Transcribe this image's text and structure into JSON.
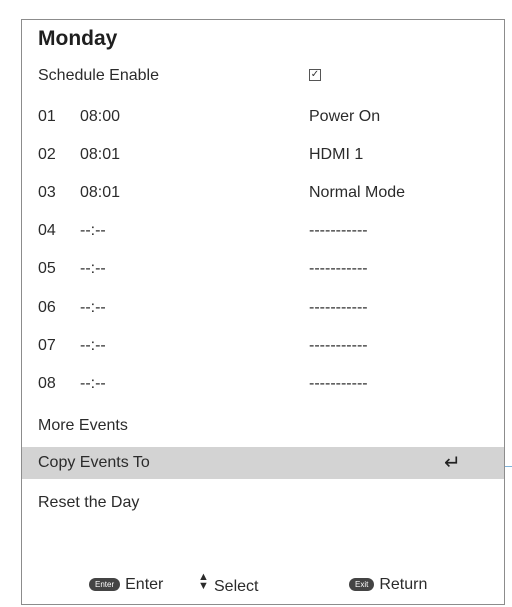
{
  "title": "Monday",
  "schedule_enable": {
    "label": "Schedule Enable",
    "checked": true,
    "check_glyph": "✓"
  },
  "events": [
    {
      "num": "01",
      "time": "08:00",
      "action": "Power On"
    },
    {
      "num": "02",
      "time": "08:01",
      "action": "HDMI 1"
    },
    {
      "num": "03",
      "time": "08:01",
      "action": "Normal Mode"
    },
    {
      "num": "04",
      "time": "--:--",
      "action": "-----------"
    },
    {
      "num": "05",
      "time": "--:--",
      "action": "-----------"
    },
    {
      "num": "06",
      "time": "--:--",
      "action": "-----------"
    },
    {
      "num": "07",
      "time": "--:--",
      "action": "-----------"
    },
    {
      "num": "08",
      "time": "--:--",
      "action": "-----------"
    }
  ],
  "menu": {
    "more_events": "More Events",
    "copy_events": "Copy Events To",
    "reset_day": "Reset the Day",
    "enter_icon": "↵"
  },
  "footer": {
    "enter_key": "Enter",
    "enter_label": "Enter",
    "select_label": "Select",
    "exit_key": "Exit",
    "return_label": "Return"
  },
  "colors": {
    "highlight": "#d3d3d3",
    "border": "#8c8c8c",
    "key_pill": "#444444"
  }
}
